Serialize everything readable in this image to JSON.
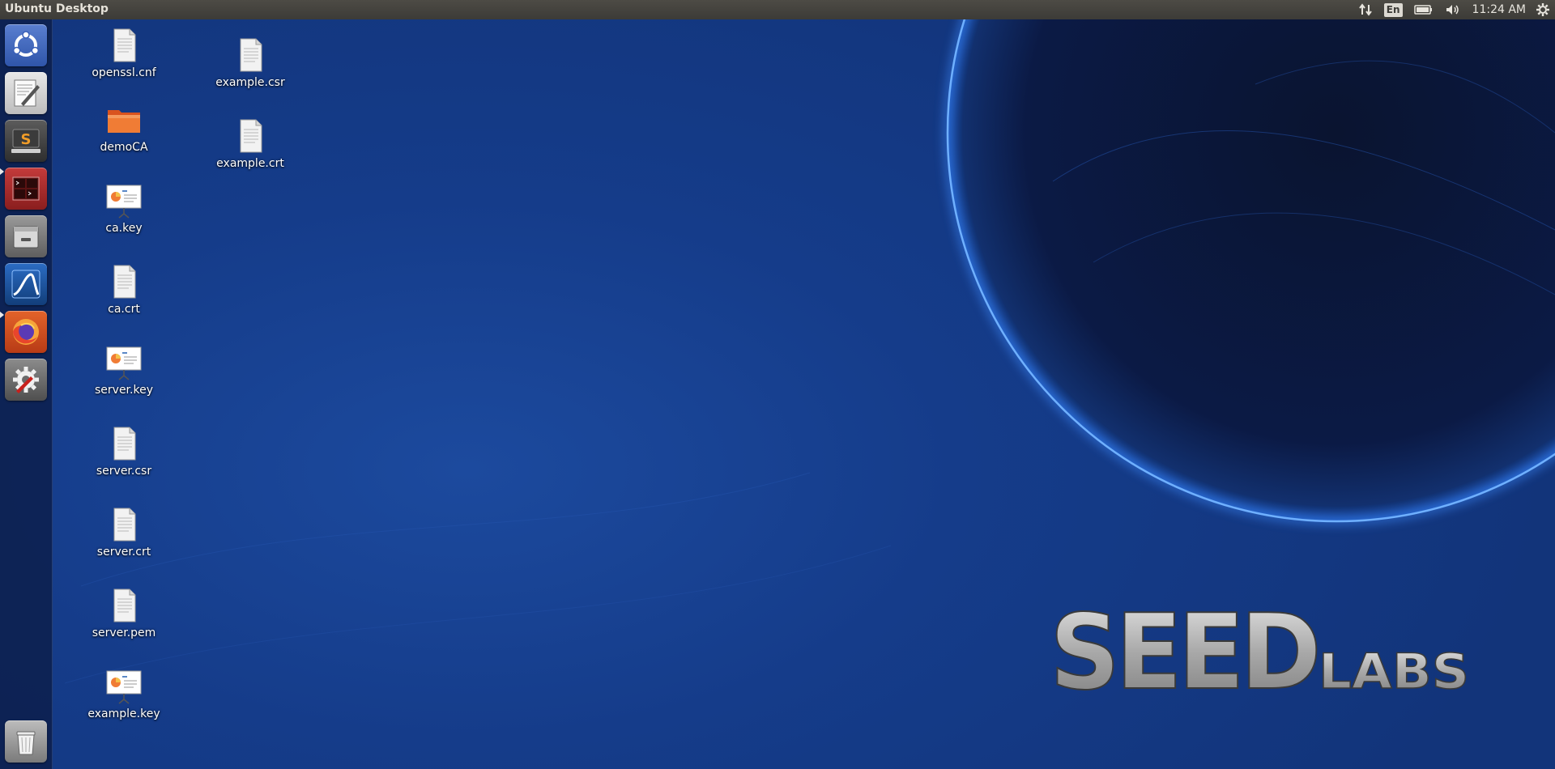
{
  "top_panel": {
    "title": "Ubuntu Desktop",
    "indicators": {
      "network_icon": "network-arrows-icon",
      "keyboard_layout": "En",
      "battery_icon": "battery-icon",
      "volume_icon": "volume-icon",
      "clock": "11:24 AM",
      "session_icon": "gear-icon"
    }
  },
  "launcher": {
    "items": [
      {
        "name": "Ubuntu Dash",
        "icon": "ubuntu-logo-icon"
      },
      {
        "name": "Text Editor",
        "icon": "text-editor-icon"
      },
      {
        "name": "Sublime Text",
        "icon": "sublime-text-icon"
      },
      {
        "name": "Terminal",
        "icon": "terminal-icon",
        "running": true
      },
      {
        "name": "Files",
        "icon": "files-icon"
      },
      {
        "name": "Wireshark",
        "icon": "wireshark-icon"
      },
      {
        "name": "Firefox",
        "icon": "firefox-icon",
        "running": true
      },
      {
        "name": "System Settings",
        "icon": "settings-icon"
      },
      {
        "name": "Trash",
        "icon": "trash-icon"
      }
    ]
  },
  "desktop": {
    "icons": [
      {
        "label": "openssl.cnf",
        "type": "document"
      },
      {
        "label": "demoCA",
        "type": "folder"
      },
      {
        "label": "ca.key",
        "type": "presentation"
      },
      {
        "label": "ca.crt",
        "type": "document"
      },
      {
        "label": "server.key",
        "type": "presentation"
      },
      {
        "label": "server.csr",
        "type": "document"
      },
      {
        "label": "server.crt",
        "type": "document"
      },
      {
        "label": "server.pem",
        "type": "document"
      },
      {
        "label": "example.key",
        "type": "presentation"
      },
      {
        "label": "example.csr",
        "type": "document"
      },
      {
        "label": "example.crt",
        "type": "document"
      }
    ]
  },
  "wallpaper": {
    "logo_main": "SEED",
    "logo_sub": "LABS",
    "accent_color": "#3d8bff",
    "background_color": "#143a86"
  }
}
